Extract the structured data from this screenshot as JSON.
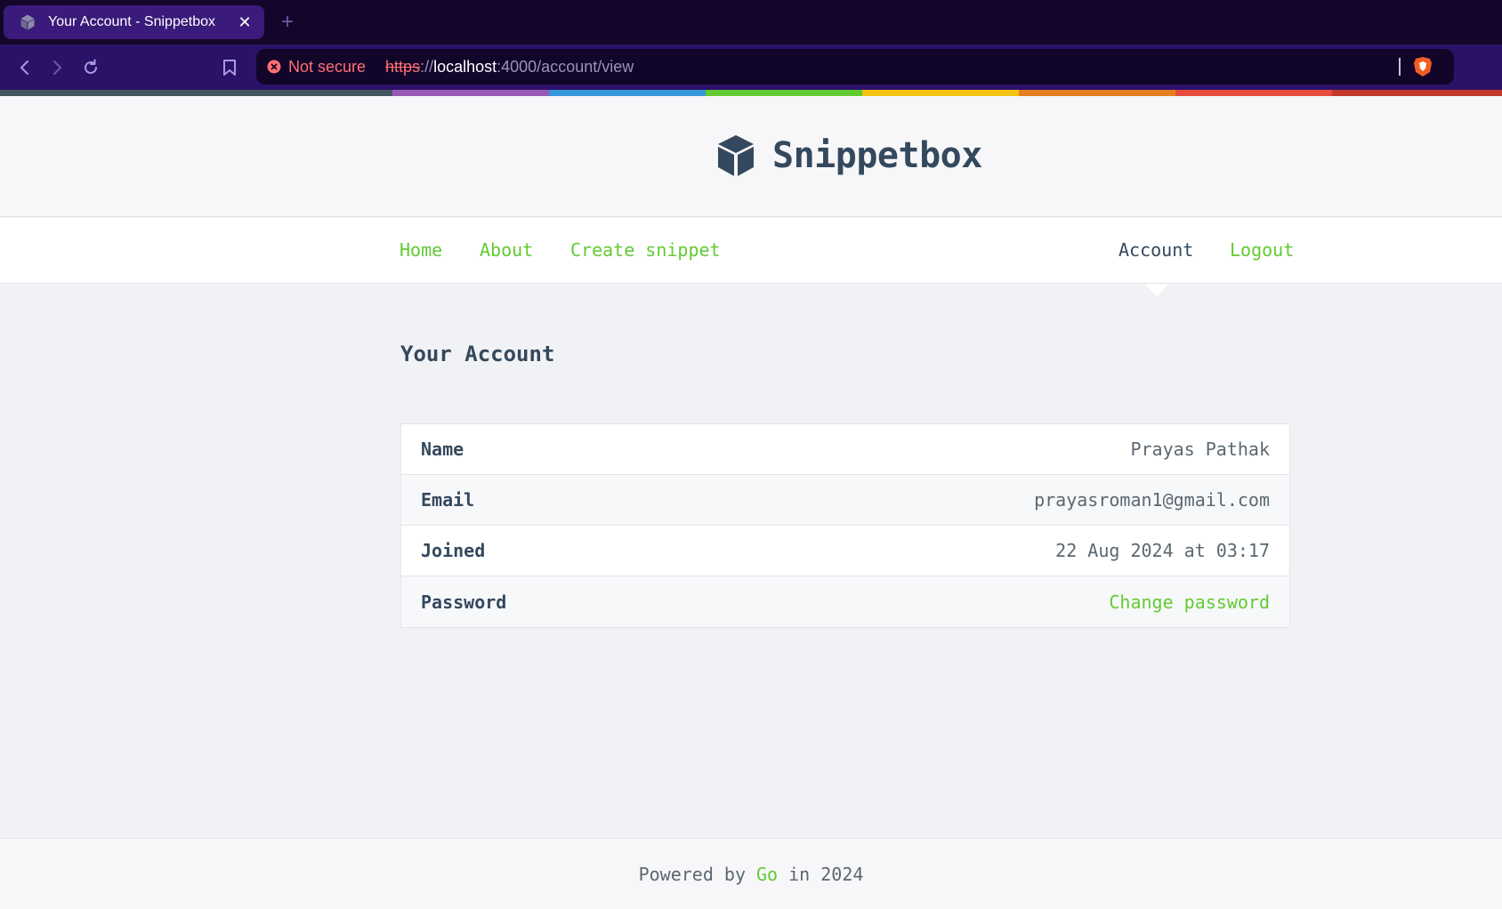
{
  "browser": {
    "tab_title": "Your Account - Snippetbox",
    "close_glyph": "✕",
    "newtab_glyph": "+",
    "security_text": "Not secure",
    "url_scheme": "https",
    "url_sep": "://",
    "url_host": "localhost",
    "url_rest": ":4000/account/view",
    "rainbow_colors": [
      "#44545f",
      "#9b59b6",
      "#3498db",
      "#62cb31",
      "#f5c211",
      "#e67e22",
      "#e74c3c",
      "#c0392b"
    ]
  },
  "site": {
    "brand": "Snippetbox",
    "nav": {
      "home": "Home",
      "about": "About",
      "create": "Create snippet",
      "account": "Account",
      "logout": "Logout"
    },
    "heading": "Your Account",
    "account": [
      {
        "label": "Name",
        "value": "Prayas Pathak"
      },
      {
        "label": "Email",
        "value": "prayasroman1@gmail.com"
      },
      {
        "label": "Joined",
        "value": "22 Aug 2024 at 03:17"
      },
      {
        "label": "Password",
        "value": "Change password"
      }
    ],
    "footer": {
      "prefix": "Powered by",
      "link": "Go",
      "suffix": "in 2024"
    }
  },
  "colors": {
    "accent": "#62cb31",
    "text": "#34495e",
    "browser_bg": "#14062b",
    "toolbar_bg": "#2c1168"
  },
  "icons": [
    "cube-icon",
    "close-icon",
    "back-icon",
    "forward-icon",
    "reload-icon",
    "bookmark-icon",
    "not-secure-icon",
    "brave-shield-icon"
  ]
}
